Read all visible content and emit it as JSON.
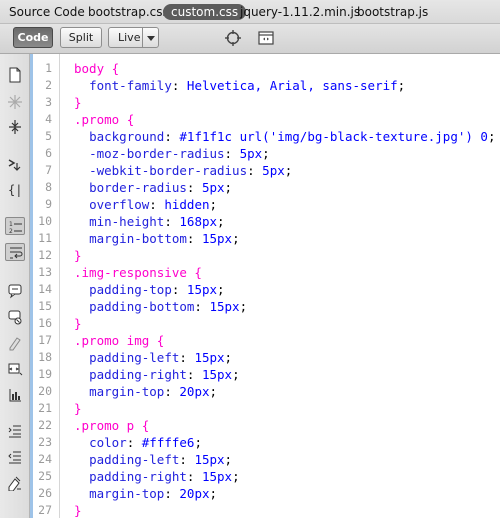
{
  "file_tabs": [
    "Source Code",
    "bootstrap.css",
    "custom.css",
    "jquery-1.11.2.min.js",
    "bootstrap.js"
  ],
  "active_file_tab": "custom.css",
  "view_buttons": {
    "code": "Code",
    "split": "Split",
    "live": "Live"
  },
  "toolbar_icons": [
    "inspect-target-icon",
    "browser-navigation-icon"
  ],
  "sidebar_tools": [
    "open-documents-icon",
    "collapse-full-tag-icon",
    "collapse-selection-icon",
    "expand-all-icon",
    "select-parent-tag-icon",
    "balance-braces-icon",
    "line-numbers-icon",
    "word-wrap-icon",
    "apply-comment-icon",
    "remove-comment-icon",
    "wrap-tag-icon",
    "recent-snippets-icon",
    "move-css-icon",
    "indent-code-icon",
    "outdent-code-icon",
    "format-source-icon"
  ],
  "colors": {
    "selector": "#ff00cc",
    "property": "#2222dd",
    "value": "#0000ff",
    "line_number": "#9a9a9a",
    "active_tab_bg": "#5c5c5c"
  },
  "code_lines": [
    {
      "n": "1",
      "sel": "body ",
      "brace": "{"
    },
    {
      "n": "2",
      "prop": "font-family",
      "val": "Helvetica, Arial, sans-serif"
    },
    {
      "n": "3",
      "brace": "}"
    },
    {
      "n": "4",
      "sel": ".promo ",
      "brace": "{"
    },
    {
      "n": "5",
      "prop": "background",
      "val": "#1f1f1c url('img/bg-black-texture.jpg') 0"
    },
    {
      "n": "6",
      "prop": "-moz-border-radius",
      "val": "5px"
    },
    {
      "n": "7",
      "prop": "-webkit-border-radius",
      "val": "5px"
    },
    {
      "n": "8",
      "prop": "border-radius",
      "val": "5px"
    },
    {
      "n": "9",
      "prop": "overflow",
      "val": "hidden"
    },
    {
      "n": "10",
      "prop": "min-height",
      "val": "168px"
    },
    {
      "n": "11",
      "prop": "margin-bottom",
      "val": "15px"
    },
    {
      "n": "12",
      "brace": "}"
    },
    {
      "n": "13",
      "sel": ".img-responsive ",
      "brace": "{"
    },
    {
      "n": "14",
      "prop": "padding-top",
      "val": "15px"
    },
    {
      "n": "15",
      "prop": "padding-bottom",
      "val": "15px"
    },
    {
      "n": "16",
      "brace": "}"
    },
    {
      "n": "17",
      "sel": ".promo img ",
      "brace": "{"
    },
    {
      "n": "18",
      "prop": "padding-left",
      "val": "15px"
    },
    {
      "n": "19",
      "prop": "padding-right",
      "val": "15px"
    },
    {
      "n": "20",
      "prop": "margin-top",
      "val": "20px"
    },
    {
      "n": "21",
      "brace": "}"
    },
    {
      "n": "22",
      "sel": ".promo p ",
      "brace": "{"
    },
    {
      "n": "23",
      "prop": "color",
      "val": "#ffffe6"
    },
    {
      "n": "24",
      "prop": "padding-left",
      "val": "15px"
    },
    {
      "n": "25",
      "prop": "padding-right",
      "val": "15px"
    },
    {
      "n": "26",
      "prop": "margin-top",
      "val": "20px"
    },
    {
      "n": "27",
      "brace": "}"
    }
  ]
}
